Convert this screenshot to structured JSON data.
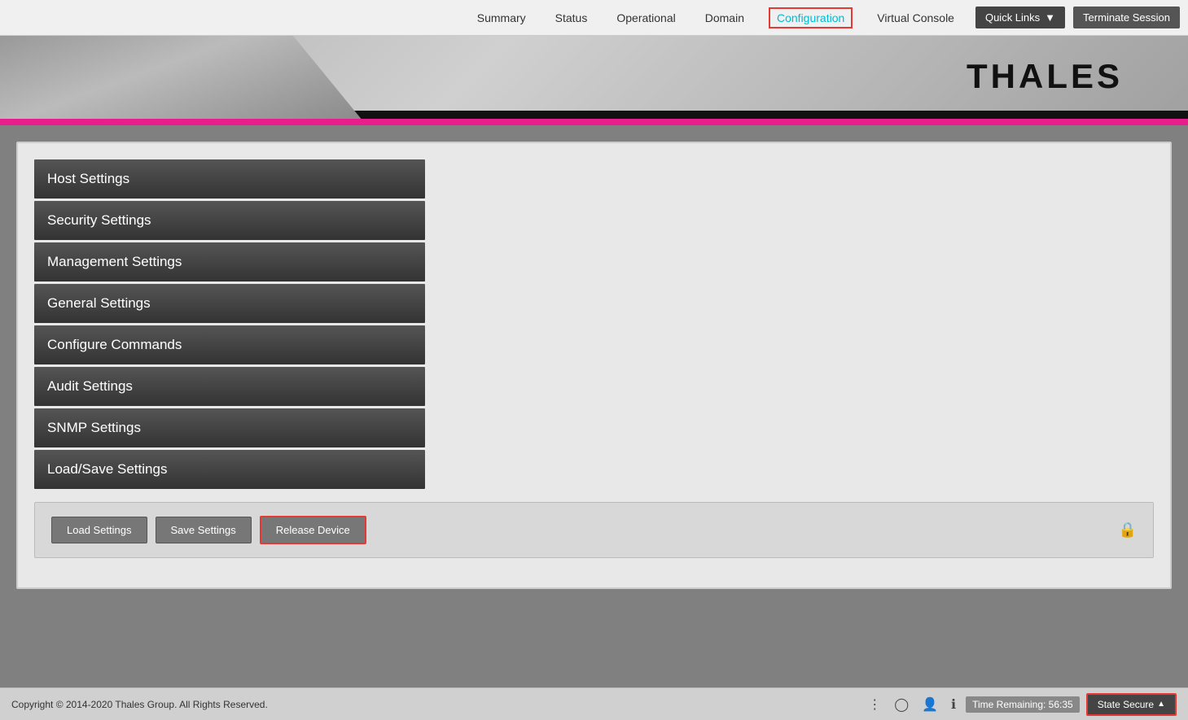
{
  "nav": {
    "items": [
      {
        "id": "summary",
        "label": "Summary",
        "active": false
      },
      {
        "id": "status",
        "label": "Status",
        "active": false
      },
      {
        "id": "operational",
        "label": "Operational",
        "active": false
      },
      {
        "id": "domain",
        "label": "Domain",
        "active": false
      },
      {
        "id": "configuration",
        "label": "Configuration",
        "active": true
      },
      {
        "id": "virtual-console",
        "label": "Virtual Console",
        "active": false
      }
    ],
    "quick_links_label": "Quick Links",
    "terminate_label": "Terminate Session"
  },
  "header": {
    "logo_text": "THALES"
  },
  "sidebar": {
    "items": [
      {
        "id": "host-settings",
        "label": "Host Settings"
      },
      {
        "id": "security-settings",
        "label": "Security Settings"
      },
      {
        "id": "management-settings",
        "label": "Management Settings"
      },
      {
        "id": "general-settings",
        "label": "General Settings"
      },
      {
        "id": "configure-commands",
        "label": "Configure Commands"
      },
      {
        "id": "audit-settings",
        "label": "Audit Settings"
      },
      {
        "id": "snmp-settings",
        "label": "SNMP Settings"
      },
      {
        "id": "load-save-settings",
        "label": "Load/Save Settings"
      }
    ]
  },
  "action_bar": {
    "load_label": "Load Settings",
    "save_label": "Save Settings",
    "release_label": "Release Device"
  },
  "footer": {
    "copyright": "Copyright © 2014-2020 Thales Group. All Rights Reserved.",
    "time_remaining_label": "Time Remaining: 56:35",
    "state_secure_label": "State Secure"
  }
}
